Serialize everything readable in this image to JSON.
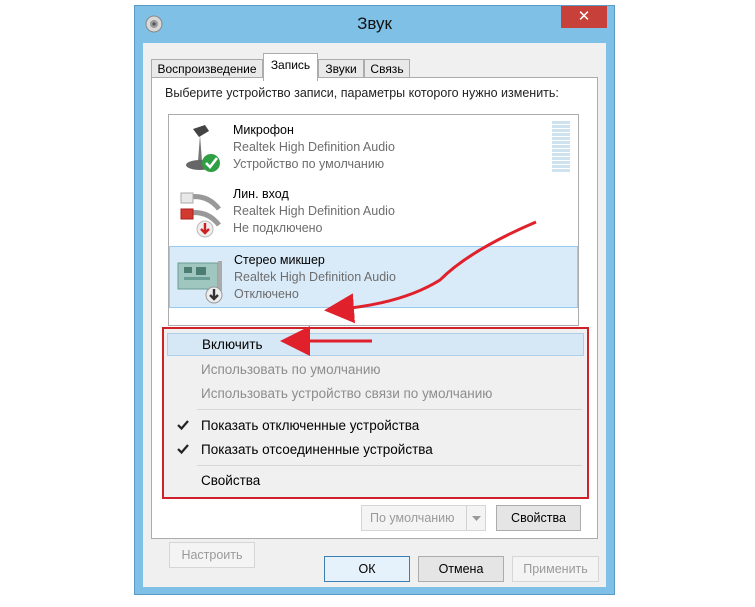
{
  "window": {
    "title": "Звук",
    "close_glyph": "✕"
  },
  "tabs": [
    {
      "label": "Воспроизведение",
      "active": false
    },
    {
      "label": "Запись",
      "active": true
    },
    {
      "label": "Звуки",
      "active": false
    },
    {
      "label": "Связь",
      "active": false
    }
  ],
  "panel": {
    "instruction": "Выберите устройство записи, параметры которого нужно изменить:"
  },
  "devices": [
    {
      "name": "Микрофон",
      "driver": "Realtek High Definition Audio",
      "status": "Устройство по умолчанию",
      "icon": "microphone-icon",
      "badge": "default-check"
    },
    {
      "name": "Лин. вход",
      "driver": "Realtek High Definition Audio",
      "status": "Не подключено",
      "icon": "line-in-icon",
      "badge": "unplugged-red"
    },
    {
      "name": "Стерео микшер",
      "driver": "Realtek High Definition Audio",
      "status": "Отключено",
      "icon": "stereo-mixer-icon",
      "badge": "disabled-gray",
      "selected": true
    }
  ],
  "context_menu": {
    "items": [
      {
        "label": "Включить",
        "highlighted": true,
        "enabled": true,
        "checked": false
      },
      {
        "label": "Использовать по умолчанию",
        "enabled": false,
        "checked": false
      },
      {
        "label": "Использовать устройство связи по умолчанию",
        "enabled": false,
        "checked": false
      },
      {
        "label": "Показать отключенные устройства",
        "enabled": true,
        "checked": true
      },
      {
        "label": "Показать отсоединенные устройства",
        "enabled": true,
        "checked": true
      },
      {
        "label": "Свойства",
        "enabled": true,
        "checked": false
      }
    ]
  },
  "panel_buttons": {
    "configure": "Настроить",
    "set_default": "По умолчанию",
    "properties": "Свойства"
  },
  "dialog_buttons": {
    "ok": "ОК",
    "cancel": "Отмена",
    "apply": "Применить"
  },
  "colors": {
    "title_bar": "#7fc0e7",
    "close_button": "#c7413a",
    "highlight_box": "#d0202a",
    "arrow": "#e0202a",
    "selection": "#d9ebf9"
  }
}
